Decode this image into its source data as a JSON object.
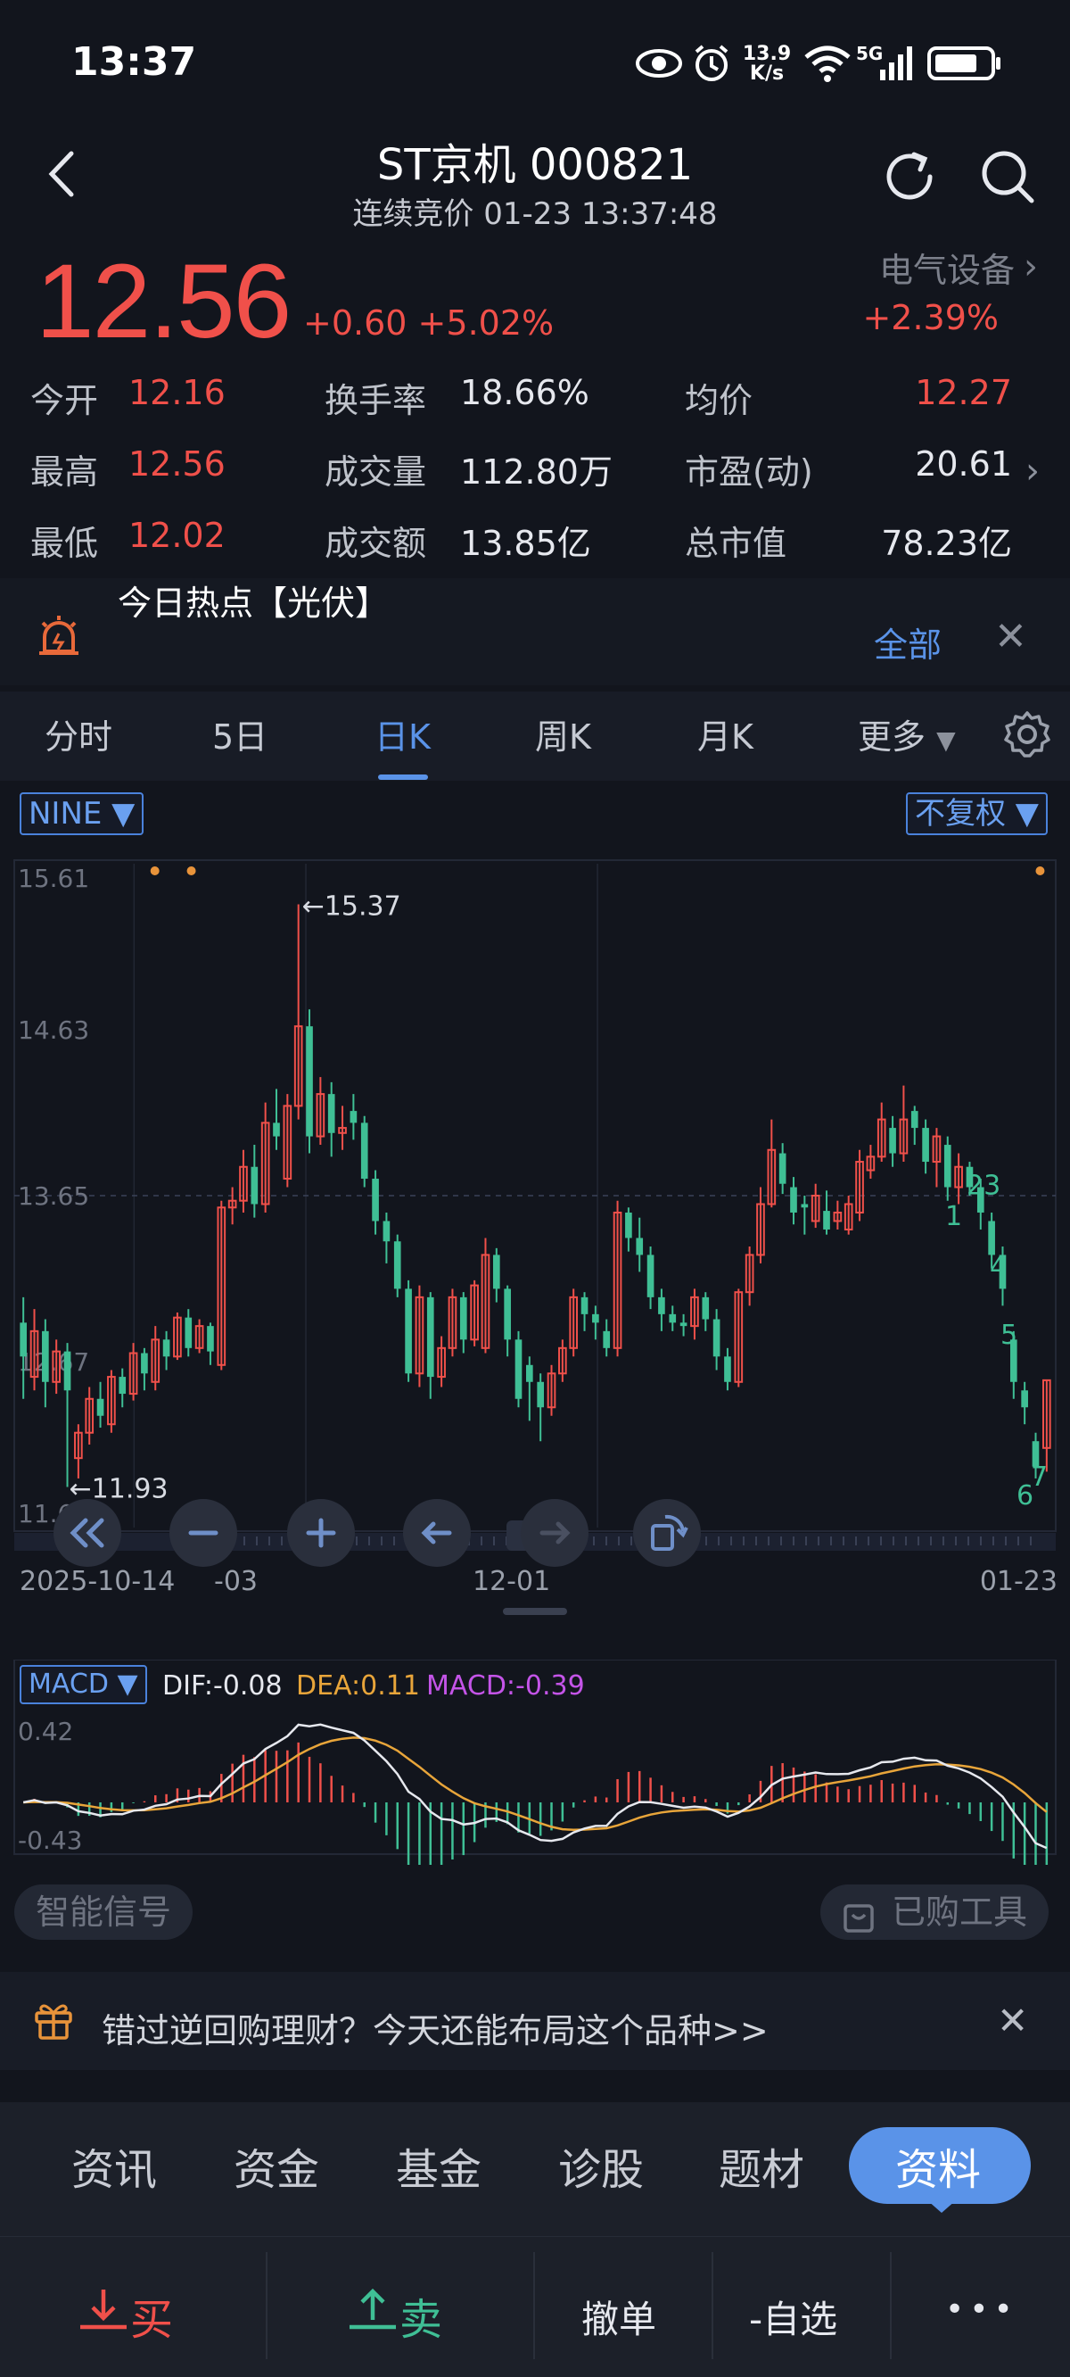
{
  "status_bar": {
    "time": "13:37",
    "net_speed_value": "13.9",
    "net_speed_unit": "K/s",
    "network": "5G",
    "icons": [
      "eye-icon",
      "alarm-icon",
      "wifi-icon",
      "signal-icon",
      "battery-icon"
    ]
  },
  "header": {
    "title": "ST京机 000821",
    "subtitle": "连续竞价 01-23 13:37:48"
  },
  "quote": {
    "price": "12.56",
    "change": "+0.60",
    "change_pct": "+5.02%",
    "industry": "电气设备",
    "industry_change": "+2.39%"
  },
  "stats": [
    {
      "label": "今开",
      "value": "12.16",
      "color": "#f0504a"
    },
    {
      "label": "换手率",
      "value": "18.66%",
      "color": "#e6e8ee"
    },
    {
      "label": "均价",
      "value": "12.27",
      "color": "#f0504a"
    },
    {
      "label": "最高",
      "value": "12.56",
      "color": "#f0504a"
    },
    {
      "label": "成交量",
      "value": "112.80万",
      "color": "#e6e8ee"
    },
    {
      "label": "市盈(动)",
      "value": "20.61",
      "color": "#e6e8ee"
    },
    {
      "label": "最低",
      "value": "12.02",
      "color": "#f0504a"
    },
    {
      "label": "成交额",
      "value": "13.85亿",
      "color": "#e6e8ee"
    },
    {
      "label": "总市值",
      "value": "78.23亿",
      "color": "#e6e8ee"
    }
  ],
  "hotspot": {
    "title": "今日热点【光伏】",
    "all_label": "全部"
  },
  "chart_tabs": [
    "分时",
    "5日",
    "日K",
    "周K",
    "月K",
    "更多"
  ],
  "chart_active_tab": "日K",
  "kchart": {
    "indicator_chip": "NINE ▼",
    "adjust_chip": "不复权 ▼",
    "y_ticks": [
      "15.61",
      "14.63",
      "13.65",
      "12.67",
      "11.69"
    ],
    "x_labels": [
      "2025-10-14",
      "-03",
      "12-01",
      "01-23"
    ],
    "max_label": "←15.37",
    "min_label": "←11.93",
    "nine_labels": [
      "1",
      "23",
      "4",
      "5",
      "6",
      "7"
    ],
    "range_handle": "‹|›"
  },
  "chart_data": {
    "type": "candlestick",
    "title": "",
    "ylim": [
      11.69,
      15.61
    ],
    "x_start": "2025-10-14",
    "x_end": "01-23",
    "candles": [
      [
        12.9,
        12.7,
        13.05,
        12.45
      ],
      [
        12.58,
        12.85,
        12.98,
        12.5
      ],
      [
        12.85,
        12.55,
        12.92,
        12.4
      ],
      [
        12.55,
        12.73,
        12.8,
        12.48
      ],
      [
        12.73,
        12.5,
        12.78,
        11.93
      ],
      [
        12.1,
        12.25,
        12.3,
        11.98
      ],
      [
        12.25,
        12.45,
        12.52,
        12.18
      ],
      [
        12.45,
        12.35,
        12.55,
        12.28
      ],
      [
        12.3,
        12.58,
        12.62,
        12.25
      ],
      [
        12.58,
        12.48,
        12.63,
        12.4
      ],
      [
        12.48,
        12.72,
        12.78,
        12.44
      ],
      [
        12.72,
        12.6,
        12.75,
        12.5
      ],
      [
        12.55,
        12.8,
        12.88,
        12.5
      ],
      [
        12.8,
        12.7,
        12.85,
        12.62
      ],
      [
        12.7,
        12.93,
        12.96,
        12.68
      ],
      [
        12.93,
        12.75,
        12.98,
        12.7
      ],
      [
        12.75,
        12.88,
        12.92,
        12.72
      ],
      [
        12.88,
        12.73,
        12.9,
        12.65
      ],
      [
        12.65,
        13.58,
        13.62,
        12.62
      ],
      [
        13.58,
        13.62,
        13.7,
        13.48
      ],
      [
        13.62,
        13.82,
        13.92,
        13.55
      ],
      [
        13.82,
        13.6,
        13.95,
        13.52
      ],
      [
        13.6,
        14.08,
        14.2,
        13.55
      ],
      [
        14.08,
        14.0,
        14.28,
        13.92
      ],
      [
        13.75,
        14.18,
        14.25,
        13.7
      ],
      [
        14.18,
        14.65,
        15.37,
        14.1
      ],
      [
        14.65,
        14.0,
        14.75,
        13.9
      ],
      [
        14.0,
        14.25,
        14.35,
        13.95
      ],
      [
        14.25,
        14.02,
        14.32,
        13.88
      ],
      [
        14.02,
        14.05,
        14.18,
        13.92
      ],
      [
        14.15,
        14.08,
        14.25,
        13.98
      ],
      [
        14.08,
        13.75,
        14.12,
        13.7
      ],
      [
        13.75,
        13.5,
        13.8,
        13.42
      ],
      [
        13.5,
        13.38,
        13.55,
        13.25
      ],
      [
        13.38,
        13.1,
        13.42,
        13.05
      ],
      [
        13.1,
        12.6,
        13.15,
        12.55
      ],
      [
        12.6,
        13.05,
        13.12,
        12.52
      ],
      [
        13.05,
        12.58,
        13.08,
        12.45
      ],
      [
        12.58,
        12.75,
        12.82,
        12.52
      ],
      [
        12.75,
        13.05,
        13.1,
        12.7
      ],
      [
        13.05,
        12.8,
        13.08,
        12.72
      ],
      [
        12.8,
        13.12,
        13.15,
        12.76
      ],
      [
        12.75,
        13.3,
        13.4,
        12.72
      ],
      [
        13.3,
        13.1,
        13.34,
        13.02
      ],
      [
        13.1,
        12.8,
        13.12,
        12.7
      ],
      [
        12.8,
        12.45,
        12.85,
        12.4
      ],
      [
        12.65,
        12.55,
        12.7,
        12.32
      ],
      [
        12.55,
        12.4,
        12.6,
        12.2
      ],
      [
        12.4,
        12.6,
        12.65,
        12.35
      ],
      [
        12.6,
        12.75,
        12.8,
        12.55
      ],
      [
        12.75,
        13.05,
        13.1,
        12.7
      ],
      [
        13.05,
        12.95,
        13.08,
        12.85
      ],
      [
        12.95,
        12.9,
        13.0,
        12.8
      ],
      [
        12.85,
        12.75,
        12.92,
        12.7
      ],
      [
        12.75,
        13.55,
        13.62,
        12.7
      ],
      [
        13.55,
        13.4,
        13.58,
        13.32
      ],
      [
        13.4,
        13.3,
        13.52,
        13.2
      ],
      [
        13.3,
        13.05,
        13.35,
        12.98
      ],
      [
        13.05,
        12.95,
        13.1,
        12.85
      ],
      [
        12.95,
        12.9,
        13.0,
        12.85
      ],
      [
        12.9,
        12.88,
        12.95,
        12.82
      ],
      [
        12.88,
        13.05,
        13.1,
        12.8
      ],
      [
        13.05,
        12.92,
        13.08,
        12.85
      ],
      [
        12.92,
        12.7,
        12.98,
        12.62
      ],
      [
        12.7,
        12.55,
        12.75,
        12.5
      ],
      [
        12.55,
        13.08,
        13.1,
        12.52
      ],
      [
        13.08,
        13.3,
        13.35,
        13.0
      ],
      [
        13.3,
        13.6,
        13.7,
        13.25
      ],
      [
        13.6,
        13.92,
        14.1,
        13.58
      ],
      [
        13.9,
        13.72,
        13.96,
        13.66
      ],
      [
        13.7,
        13.55,
        13.76,
        13.48
      ],
      [
        13.6,
        13.58,
        13.65,
        13.42
      ],
      [
        13.5,
        13.65,
        13.72,
        13.46
      ],
      [
        13.56,
        13.45,
        13.68,
        13.42
      ],
      [
        13.5,
        13.55,
        13.62,
        13.45
      ],
      [
        13.45,
        13.6,
        13.65,
        13.42
      ],
      [
        13.55,
        13.85,
        13.92,
        13.5
      ],
      [
        13.8,
        13.88,
        13.95,
        13.75
      ],
      [
        13.88,
        14.1,
        14.2,
        13.85
      ],
      [
        14.05,
        13.9,
        14.12,
        13.82
      ],
      [
        13.9,
        14.1,
        14.3,
        13.85
      ],
      [
        14.15,
        14.05,
        14.18,
        13.95
      ],
      [
        14.05,
        13.85,
        14.1,
        13.78
      ],
      [
        13.85,
        14.0,
        14.05,
        13.7
      ],
      [
        13.95,
        13.7,
        14.0,
        13.62
      ],
      [
        13.7,
        13.82,
        13.9,
        13.6
      ],
      [
        13.82,
        13.7,
        13.85,
        13.65
      ],
      [
        13.7,
        13.55,
        13.75,
        13.45
      ],
      [
        13.5,
        13.3,
        13.55,
        13.22
      ],
      [
        13.3,
        13.1,
        13.35,
        13.0
      ],
      [
        12.8,
        12.55,
        12.85,
        12.45
      ],
      [
        12.5,
        12.4,
        12.55,
        12.3
      ],
      [
        12.2,
        12.05,
        12.25,
        11.98
      ],
      [
        12.16,
        12.56,
        12.56,
        12.02
      ]
    ],
    "max_marker": 15.37,
    "min_marker": 11.93,
    "macd": {
      "dif": -0.08,
      "dea": 0.11,
      "macd": -0.39,
      "ylim": [
        -0.43,
        0.42
      ]
    }
  },
  "macd_panel": {
    "chip": "MACD ▼",
    "dif_label": "DIF:-0.08",
    "dea_label": "DEA:0.11",
    "macd_label": "MACD:-0.39",
    "y_top": "0.42",
    "y_bottom": "-0.43"
  },
  "signals": {
    "smart_signal": "智能信号",
    "purchased_tools": "已购工具"
  },
  "ad": {
    "text": "错过逆回购理财？今天还能布局这个品种>>"
  },
  "bottom_tabs": [
    "资讯",
    "资金",
    "基金",
    "诊股",
    "题材",
    "资料"
  ],
  "bottom_active_tab": "资料",
  "actions": {
    "buy": "买",
    "sell": "卖",
    "cancel": "撤单",
    "watchlist": "自选",
    "more": "•••"
  },
  "colors": {
    "up": "#f0504a",
    "down": "#3fbf95",
    "accent": "#5a93e8",
    "dea": "#e8a53a",
    "macd_text": "#c454e8"
  }
}
